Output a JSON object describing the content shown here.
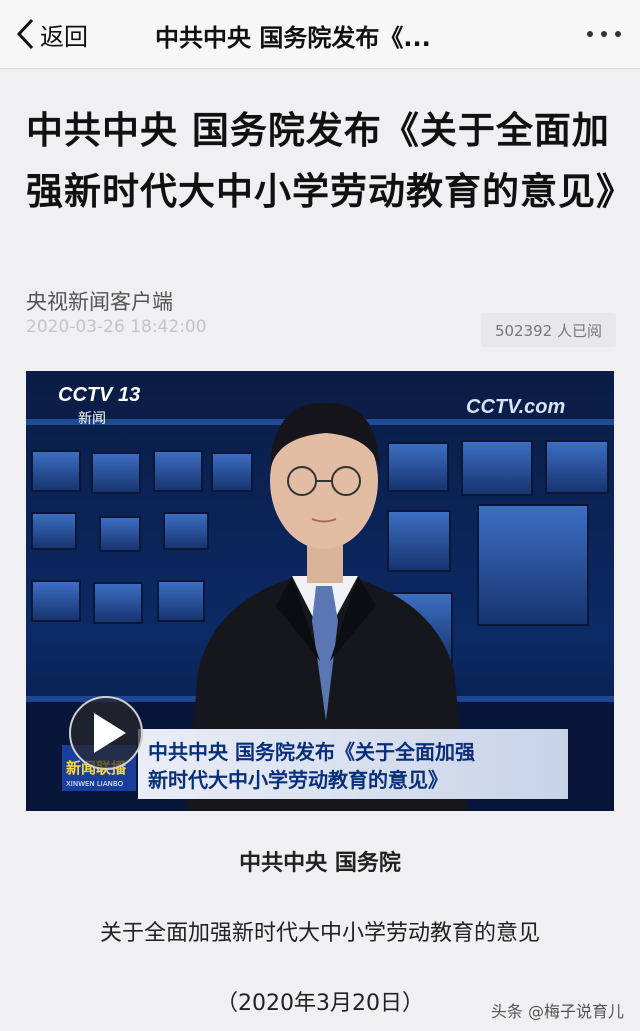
{
  "nav": {
    "back_label": "返回",
    "title": "中共中央 国务院发布《..."
  },
  "article": {
    "title": "中共中央 国务院发布《关于全面加强新时代大中小学劳动教育的意见》",
    "source": "央视新闻客户端",
    "date": "2020-03-26 18:42:00",
    "read_count": "502392 人已阅"
  },
  "video": {
    "channel_logo": "CCTV 13",
    "channel_sub": "新闻",
    "corner_logo": "CCTV.com",
    "program_logo": "新闻联播",
    "program_logo_en": "XINWEN LIANBO",
    "caption_line1": "中共中央 国务院发布《关于全面加强",
    "caption_line2": "新时代大中小学劳动教育的意见》",
    "play_icon": "play-icon"
  },
  "body": {
    "line1": "中共中央 国务院",
    "line2": "关于全面加强新时代大中小学劳动教育的意见",
    "line3": "（2020年3月20日）"
  },
  "watermark": "头条 @梅子说育儿",
  "colors": {
    "studio_blue": "#0c2a66",
    "caption_blue": "#0a2f7a",
    "nav_bg": "#f7f7f7"
  }
}
